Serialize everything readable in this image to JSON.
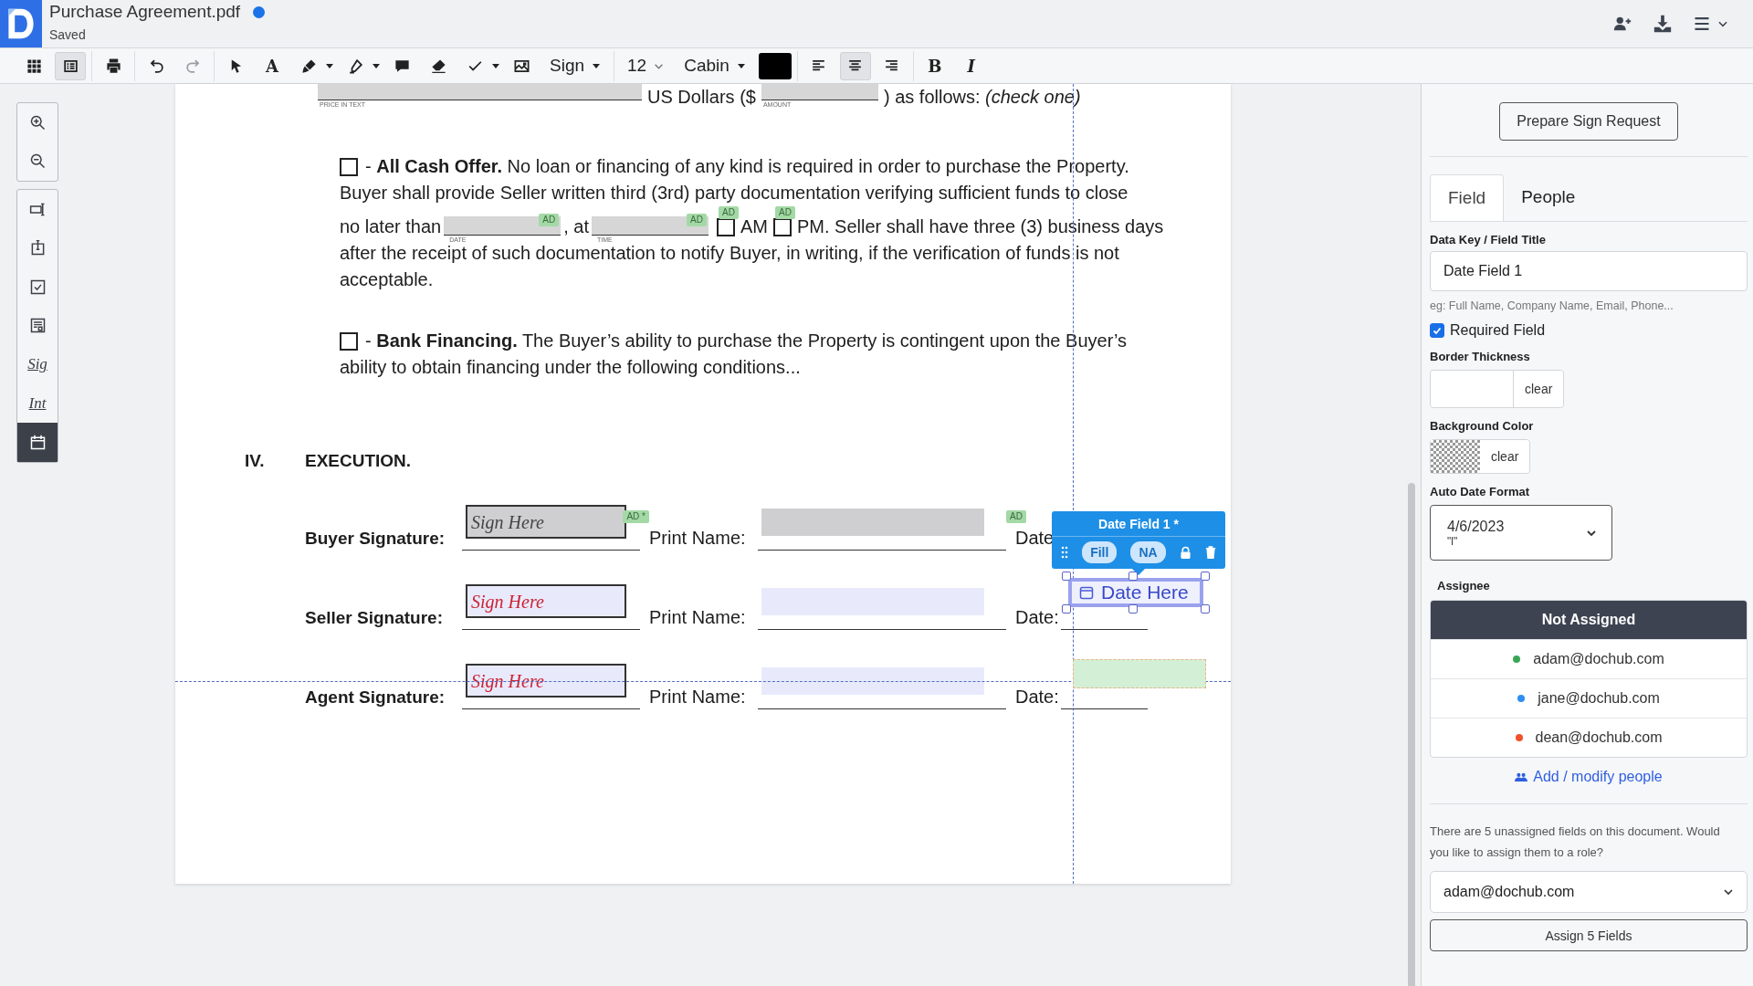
{
  "document": {
    "title": "Purchase Agreement.pdf",
    "modified": true,
    "status": "Saved"
  },
  "toolbar": [
    {
      "items": [
        {
          "kind": "grid",
          "selected": false
        },
        {
          "kind": "list",
          "selected": true
        }
      ]
    },
    {
      "items": [
        {
          "kind": "print",
          "selected": false
        }
      ]
    },
    {
      "items": [
        {
          "kind": "undo",
          "selected": false
        },
        {
          "kind": "redo",
          "selected": false,
          "disabled": true
        }
      ]
    },
    {
      "items": [
        {
          "kind": "pointer",
          "selected": false
        },
        {
          "kind": "glyph",
          "label": "A",
          "selected": false
        },
        {
          "kind": "pen",
          "selected": false,
          "caret": true
        },
        {
          "kind": "highlighter",
          "selected": false,
          "caret": true
        },
        {
          "kind": "comment",
          "selected": false
        },
        {
          "kind": "eraser",
          "selected": false
        },
        {
          "kind": "check",
          "selected": false,
          "caret": true
        },
        {
          "kind": "image",
          "selected": false
        },
        {
          "kind": "dropdown",
          "label": "Sign",
          "caret": true
        }
      ]
    },
    {
      "items": [
        {
          "kind": "size",
          "label": "12"
        },
        {
          "kind": "dropdown",
          "label": "Cabin",
          "caret": true
        },
        {
          "kind": "color",
          "color": "#000000"
        }
      ]
    },
    {
      "items": [
        {
          "kind": "align-left",
          "selected": false
        },
        {
          "kind": "align-center",
          "selected": true
        },
        {
          "kind": "align-right",
          "selected": false
        }
      ]
    },
    {
      "items": [
        {
          "kind": "glyph",
          "label": "B",
          "selected": false
        },
        {
          "kind": "glyph",
          "label": "I",
          "italic": true,
          "selected": false
        }
      ]
    }
  ],
  "rail": [
    {
      "items": [
        {
          "kind": "zoom-in",
          "selected": false
        },
        {
          "kind": "zoom-out",
          "selected": false
        }
      ]
    },
    {
      "items": [
        {
          "kind": "text-field",
          "selected": false
        },
        {
          "kind": "text-box",
          "selected": false
        },
        {
          "kind": "checkbox",
          "selected": false
        },
        {
          "kind": "form",
          "selected": false
        },
        {
          "kind": "script",
          "label": "Sig",
          "selected": false
        },
        {
          "kind": "script",
          "label": "Int",
          "selected": false
        },
        {
          "kind": "calendar",
          "selected": true
        }
      ]
    }
  ],
  "page": {
    "price_line": [
      {
        "kind": "long-field",
        "caption": "PRICE IN TEXT"
      },
      {
        "kind": "text",
        "text": "US Dollars ($"
      },
      {
        "kind": "field",
        "caption": "AMOUNT"
      },
      {
        "kind": "text",
        "text": ") as follows: *(check one)*"
      }
    ],
    "paragraphs": [
      {
        "lines": [
          [
            {
              "kind": "checkbox",
              "checked": false
            },
            {
              "kind": "text",
              "text": "- **All Cash Offer.** No loan or financing of any kind is required in order to purchase the Property."
            }
          ],
          [
            {
              "kind": "text",
              "text": "Buyer shall provide Seller written third (3rd) party documentation verifying sufficient funds to close"
            }
          ],
          [
            {
              "kind": "text",
              "text": "no later than"
            },
            {
              "kind": "field",
              "caption": "DATE",
              "tag": "AD"
            },
            {
              "kind": "text",
              "text": ", at"
            },
            {
              "kind": "field",
              "caption": "TIME",
              "tag": "AD"
            },
            {
              "kind": "checkbox",
              "checked": false,
              "tag": "AD"
            },
            {
              "kind": "text",
              "text": "AM"
            },
            {
              "kind": "checkbox",
              "checked": false,
              "tag": "AD"
            },
            {
              "kind": "text",
              "text": "PM. Seller shall have three (3) business days"
            }
          ],
          [
            {
              "kind": "text",
              "text": "after the receipt of such documentation to notify Buyer, in writing, if the verification of funds is not"
            }
          ],
          [
            {
              "kind": "text",
              "text": "acceptable."
            }
          ]
        ]
      },
      {
        "lines": [
          [
            {
              "kind": "checkbox",
              "checked": false
            },
            {
              "kind": "text",
              "text": "- **Bank Financing.** The Buyer’s ability to purchase the Property is contingent upon the Buyer’s"
            }
          ],
          [
            {
              "kind": "text",
              "text": "ability to obtain financing under the following conditions..."
            }
          ]
        ]
      }
    ],
    "section": {
      "number": "IV.",
      "title": "EXECUTION."
    },
    "signature_rows": [
      {
        "label": "Buyer Signature:",
        "sign_text": "Sign Here",
        "kind": "unassigned",
        "color": "#444444",
        "sign_tag": "AD *",
        "print_label": "Print Name:",
        "name_tag": "AD",
        "date_label": "Date"
      },
      {
        "label": "Seller Signature:",
        "sign_text": "Sign Here",
        "kind": "assigned",
        "color": "#cc2233",
        "print_label": "Print Name:",
        "date_label": "Date:"
      },
      {
        "label": "Agent Signature:",
        "sign_text": "Sign Here",
        "kind": "assigned",
        "color": "#cc2233",
        "print_label": "Print Name:",
        "date_label": "Date:"
      }
    ],
    "date_popup": {
      "title": "Date Field 1 *",
      "fill": "Fill",
      "na": "NA",
      "field_text": "Date Here"
    }
  },
  "panel": {
    "prepare_button": "Prepare Sign Request",
    "tabs": [
      {
        "label": "Field",
        "selected": true
      },
      {
        "label": "People",
        "selected": false
      }
    ],
    "field_title_label": "Data Key / Field Title",
    "field_title_value": "Date Field 1",
    "field_title_hint": "eg: Full Name, Company Name, Email, Phone...",
    "required": {
      "label": "Required Field",
      "checked": true
    },
    "border_label": "Border Thickness",
    "border_clear": "clear",
    "background_label": "Background Color",
    "background_clear": "clear",
    "date_format_label": "Auto Date Format",
    "date_format_value": "4/6/2023",
    "date_format_code": "\"l\"",
    "assignee_label": "Assignee",
    "assignees": [
      {
        "label": "Not Assigned",
        "selected": true
      },
      {
        "label": "adam@dochub.com",
        "color": "#3aa655",
        "selected": false
      },
      {
        "label": "jane@dochub.com",
        "color": "#2e8ef0",
        "selected": false
      },
      {
        "label": "dean@dochub.com",
        "color": "#f0502a",
        "selected": false
      }
    ],
    "add_people": "Add / modify people",
    "note": "There are 5 unassigned fields on this document. Would you like to assign them to a role?",
    "assign_select": "adam@dochub.com",
    "assign_button": "Assign 5 Fields"
  }
}
